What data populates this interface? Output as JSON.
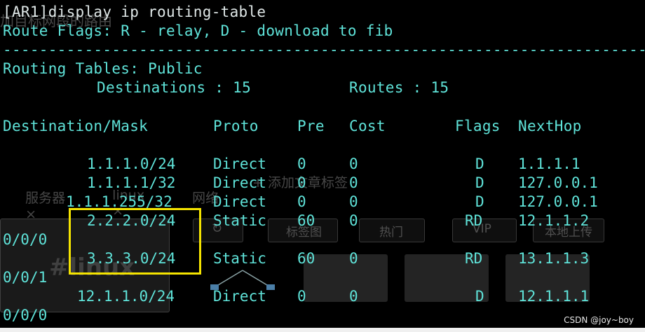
{
  "terminal": {
    "prompt_line": "[AR1]display ip routing-table",
    "flags_line": "Route Flags: R - relay, D - download to fib",
    "separator": "------------------------------------------------------------------------------",
    "tables_line": "Routing Tables: Public",
    "dest_label": "Destinations : 15",
    "routes_label": "Routes : 15",
    "headers": {
      "destination": "Destination/Mask",
      "proto": "Proto",
      "pre": "Pre",
      "cost": "Cost",
      "flags": "Flags",
      "nexthop": "NextHop"
    },
    "rows": [
      {
        "dest": "1.1.1.0/24",
        "proto": "Direct",
        "pre": "0",
        "cost": "0",
        "flags": "D",
        "nexthop": "1.1.1.1",
        "iface": ""
      },
      {
        "dest": "1.1.1.1/32",
        "proto": "Direct",
        "pre": "0",
        "cost": "0",
        "flags": "D",
        "nexthop": "127.0.0.1",
        "iface": ""
      },
      {
        "dest": "1.1.1.255/32",
        "proto": "Direct",
        "pre": "0",
        "cost": "0",
        "flags": "D",
        "nexthop": "127.0.0.1",
        "iface": ""
      },
      {
        "dest": "2.2.2.0/24",
        "proto": "Static",
        "pre": "60",
        "cost": "0",
        "flags": "RD",
        "nexthop": "12.1.1.2",
        "iface": "0/0/0"
      },
      {
        "dest": "3.3.3.0/24",
        "proto": "Static",
        "pre": "60",
        "cost": "0",
        "flags": "RD",
        "nexthop": "13.1.1.3",
        "iface": "0/0/1"
      },
      {
        "dest": "12.1.1.0/24",
        "proto": "Direct",
        "pre": "0",
        "cost": "0",
        "flags": "D",
        "nexthop": "12.1.1.1",
        "iface": "0/0/0"
      }
    ]
  },
  "overlay": {
    "title_fragment": "加目标网段的路由",
    "tag_server": "服务器",
    "tag_linux": "linux",
    "tag_network": "网络",
    "add_tag": "+ 添加文章标签",
    "btn_tag_map": "标签图",
    "btn_hot": "热门",
    "btn_vip": "VIP",
    "btn_upload": "本地上传",
    "hashtag": "#linux",
    "close_glyph": "×"
  },
  "watermark": "CSDN @joy~boy",
  "colors": {
    "terminal_text": "#5fe3d9",
    "highlight_box": "#f5e400",
    "background": "#000000"
  }
}
